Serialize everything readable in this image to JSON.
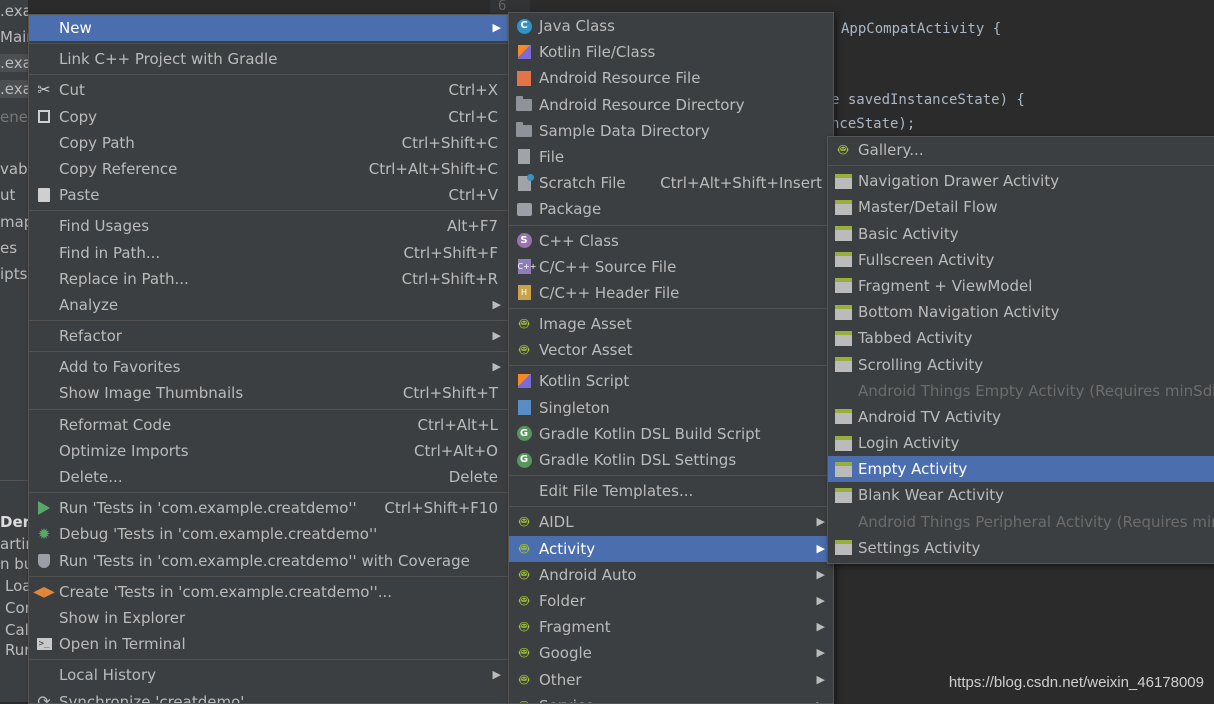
{
  "tree": {
    "items": [
      ".example.creatdemo",
      "Main",
      ".exa",
      ".exa",
      "ener",
      "vabl",
      "ut",
      "map",
      "es",
      "ipts"
    ],
    "bottom_items": [
      "Der",
      "artin",
      "n bu",
      "Loa",
      "Cor",
      "Cal",
      "Rur"
    ]
  },
  "editor": {
    "line_number": "6",
    "lines": [
      "AppCompatActivity {",
      "e savedInstanceState) {",
      "nceState);"
    ]
  },
  "watermark": "https://blog.csdn.net/weixin_46178009",
  "context_menu": {
    "new": "New",
    "link_cpp": "Link C++ Project with Gradle",
    "cut": "Cut",
    "cut_sc": "Ctrl+X",
    "copy": "Copy",
    "copy_sc": "Ctrl+C",
    "copy_path": "Copy Path",
    "copy_path_sc": "Ctrl+Shift+C",
    "copy_ref": "Copy Reference",
    "copy_ref_sc": "Ctrl+Alt+Shift+C",
    "paste": "Paste",
    "paste_sc": "Ctrl+V",
    "find_usages": "Find Usages",
    "find_usages_sc": "Alt+F7",
    "find_in_path": "Find in Path...",
    "find_in_path_sc": "Ctrl+Shift+F",
    "replace_in_path": "Replace in Path...",
    "replace_in_path_sc": "Ctrl+Shift+R",
    "analyze": "Analyze",
    "refactor": "Refactor",
    "add_favorites": "Add to Favorites",
    "show_thumbs": "Show Image Thumbnails",
    "show_thumbs_sc": "Ctrl+Shift+T",
    "reformat": "Reformat Code",
    "reformat_sc": "Ctrl+Alt+L",
    "optimize": "Optimize Imports",
    "optimize_sc": "Ctrl+Alt+O",
    "delete": "Delete...",
    "delete_sc": "Delete",
    "run_tests": "Run 'Tests in 'com.example.creatdemo''",
    "run_tests_sc": "Ctrl+Shift+F10",
    "debug_tests": "Debug 'Tests in 'com.example.creatdemo''",
    "run_cov": "Run 'Tests in 'com.example.creatdemo'' with Coverage",
    "create_tests": "Create 'Tests in 'com.example.creatdemo''...",
    "show_explorer": "Show in Explorer",
    "open_terminal": "Open in Terminal",
    "local_history": "Local History",
    "synchronize": "Synchronize 'creatdemo'"
  },
  "new_menu": {
    "java_class": "Java Class",
    "kotlin_file": "Kotlin File/Class",
    "android_res_file": "Android Resource File",
    "android_res_dir": "Android Resource Directory",
    "sample_data": "Sample Data Directory",
    "file": "File",
    "scratch": "Scratch File",
    "scratch_sc": "Ctrl+Alt+Shift+Insert",
    "package": "Package",
    "cpp_class": "C++ Class",
    "cpp_source": "C/C++ Source File",
    "cpp_header": "C/C++ Header File",
    "image_asset": "Image Asset",
    "vector_asset": "Vector Asset",
    "kotlin_script": "Kotlin Script",
    "singleton": "Singleton",
    "gradle_build": "Gradle Kotlin DSL Build Script",
    "gradle_settings": "Gradle Kotlin DSL Settings",
    "edit_templates": "Edit File Templates...",
    "aidl": "AIDL",
    "activity": "Activity",
    "android_auto": "Android Auto",
    "folder": "Folder",
    "fragment": "Fragment",
    "google": "Google",
    "other": "Other",
    "service": "Service"
  },
  "activity_menu": {
    "gallery": "Gallery...",
    "items": [
      "Navigation Drawer Activity",
      "Master/Detail Flow",
      "Basic Activity",
      "Fullscreen Activity",
      "Fragment + ViewModel",
      "Bottom Navigation Activity",
      "Tabbed Activity",
      "Scrolling Activity",
      "Android Things Empty Activity (Requires minSdk",
      "Android TV Activity",
      "Login Activity",
      "Empty Activity",
      "Blank Wear Activity",
      "Android Things Peripheral Activity (Requires minS",
      "Settings Activity"
    ]
  },
  "colors": {
    "highlight": "#4b6eaf",
    "menu_bg": "#3c3f41",
    "android_green": "#a4c639"
  }
}
